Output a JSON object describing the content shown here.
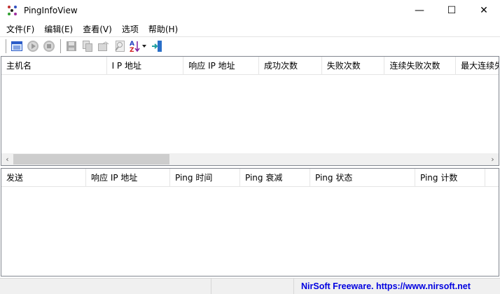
{
  "window": {
    "title": "PingInfoView",
    "minimize": "—",
    "maximize": "☐",
    "close": "✕"
  },
  "menu": [
    "文件(F)",
    "编辑(E)",
    "查看(V)",
    "选项",
    "帮助(H)"
  ],
  "toolbar": [
    "properties-icon",
    "start-icon",
    "stop-icon",
    "save-icon",
    "copy-icon",
    "html-report-icon",
    "find-icon",
    "sort-icon",
    "exit-icon"
  ],
  "upper_columns": [
    "主机名",
    "I P 地址",
    "响应 IP 地址",
    "成功次数",
    "失败次数",
    "连续失败次数",
    "最大连续失"
  ],
  "lower_columns": [
    "发送",
    "响应 IP 地址",
    "Ping 时间",
    "Ping 衰减",
    "Ping 状态",
    "Ping 计数"
  ],
  "status": {
    "link": "NirSoft Freeware. https://www.nirsoft.net"
  },
  "colors": {
    "link": "#0000e0",
    "border": "#828790"
  }
}
